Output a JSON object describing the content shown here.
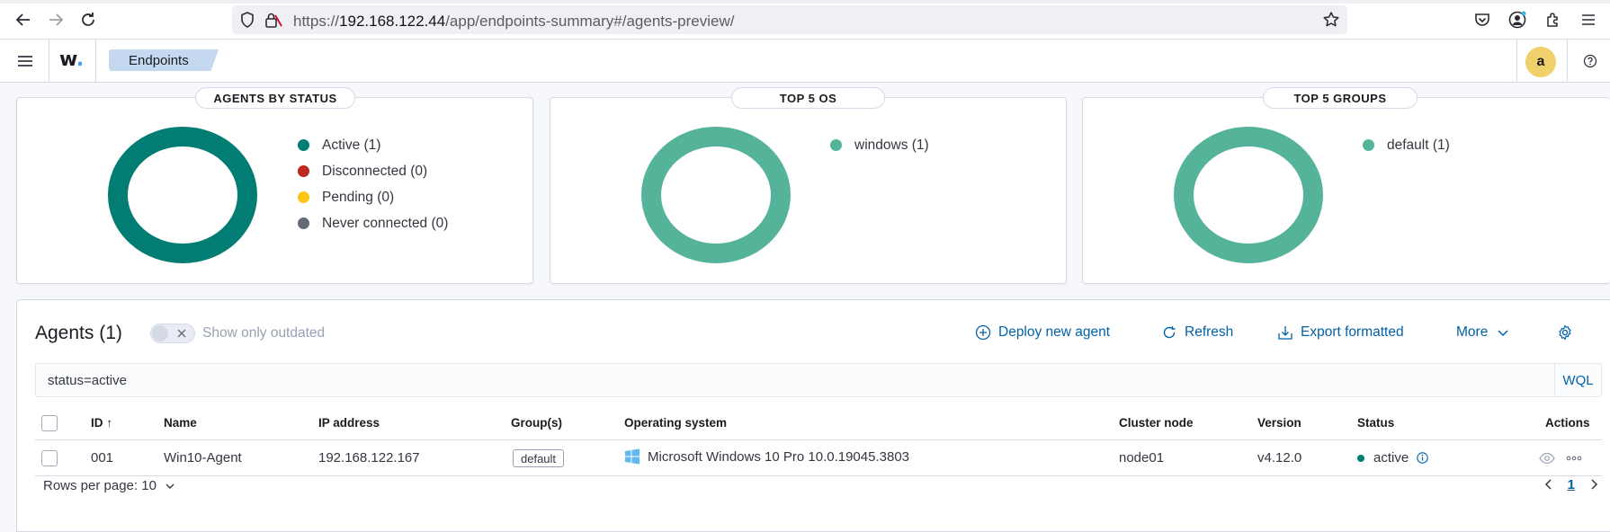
{
  "browser": {
    "url_prefix": "https://",
    "url_host": "192.168.122.44",
    "url_path": "/app/endpoints-summary#/agents-preview/"
  },
  "header": {
    "logo": "w",
    "logo_dot": ".",
    "breadcrumb": "Endpoints",
    "avatar_initial": "a"
  },
  "cards": [
    {
      "title": "AGENTS BY STATUS",
      "donut_color": "#017d73",
      "legend": [
        {
          "label": "Active (1)",
          "color": "#017d73"
        },
        {
          "label": "Disconnected (0)",
          "color": "#bd271e"
        },
        {
          "label": "Pending (0)",
          "color": "#fec514"
        },
        {
          "label": "Never connected (0)",
          "color": "#646a77"
        }
      ]
    },
    {
      "title": "TOP 5 OS",
      "donut_color": "#54b399",
      "legend": [
        {
          "label": "windows (1)",
          "color": "#54b399"
        }
      ]
    },
    {
      "title": "TOP 5 GROUPS",
      "donut_color": "#54b399",
      "legend": [
        {
          "label": "default (1)",
          "color": "#54b399"
        }
      ]
    }
  ],
  "agents": {
    "title": "Agents (1)",
    "toggle_label": "Show only outdated",
    "actions": {
      "deploy": "Deploy new agent",
      "refresh": "Refresh",
      "export": "Export formatted",
      "more": "More"
    },
    "search_query": "status=active",
    "wql_label": "WQL",
    "columns": {
      "id": "ID",
      "name": "Name",
      "ip": "IP address",
      "groups": "Group(s)",
      "os": "Operating system",
      "cluster": "Cluster node",
      "version": "Version",
      "status": "Status",
      "actions": "Actions"
    },
    "rows": [
      {
        "id": "001",
        "name": "Win10-Agent",
        "ip": "192.168.122.167",
        "group": "default",
        "os": "Microsoft Windows 10 Pro 10.0.19045.3803",
        "cluster": "node01",
        "version": "v4.12.0",
        "status": "active"
      }
    ],
    "rows_per_page": "Rows per page: 10",
    "current_page": "1"
  }
}
